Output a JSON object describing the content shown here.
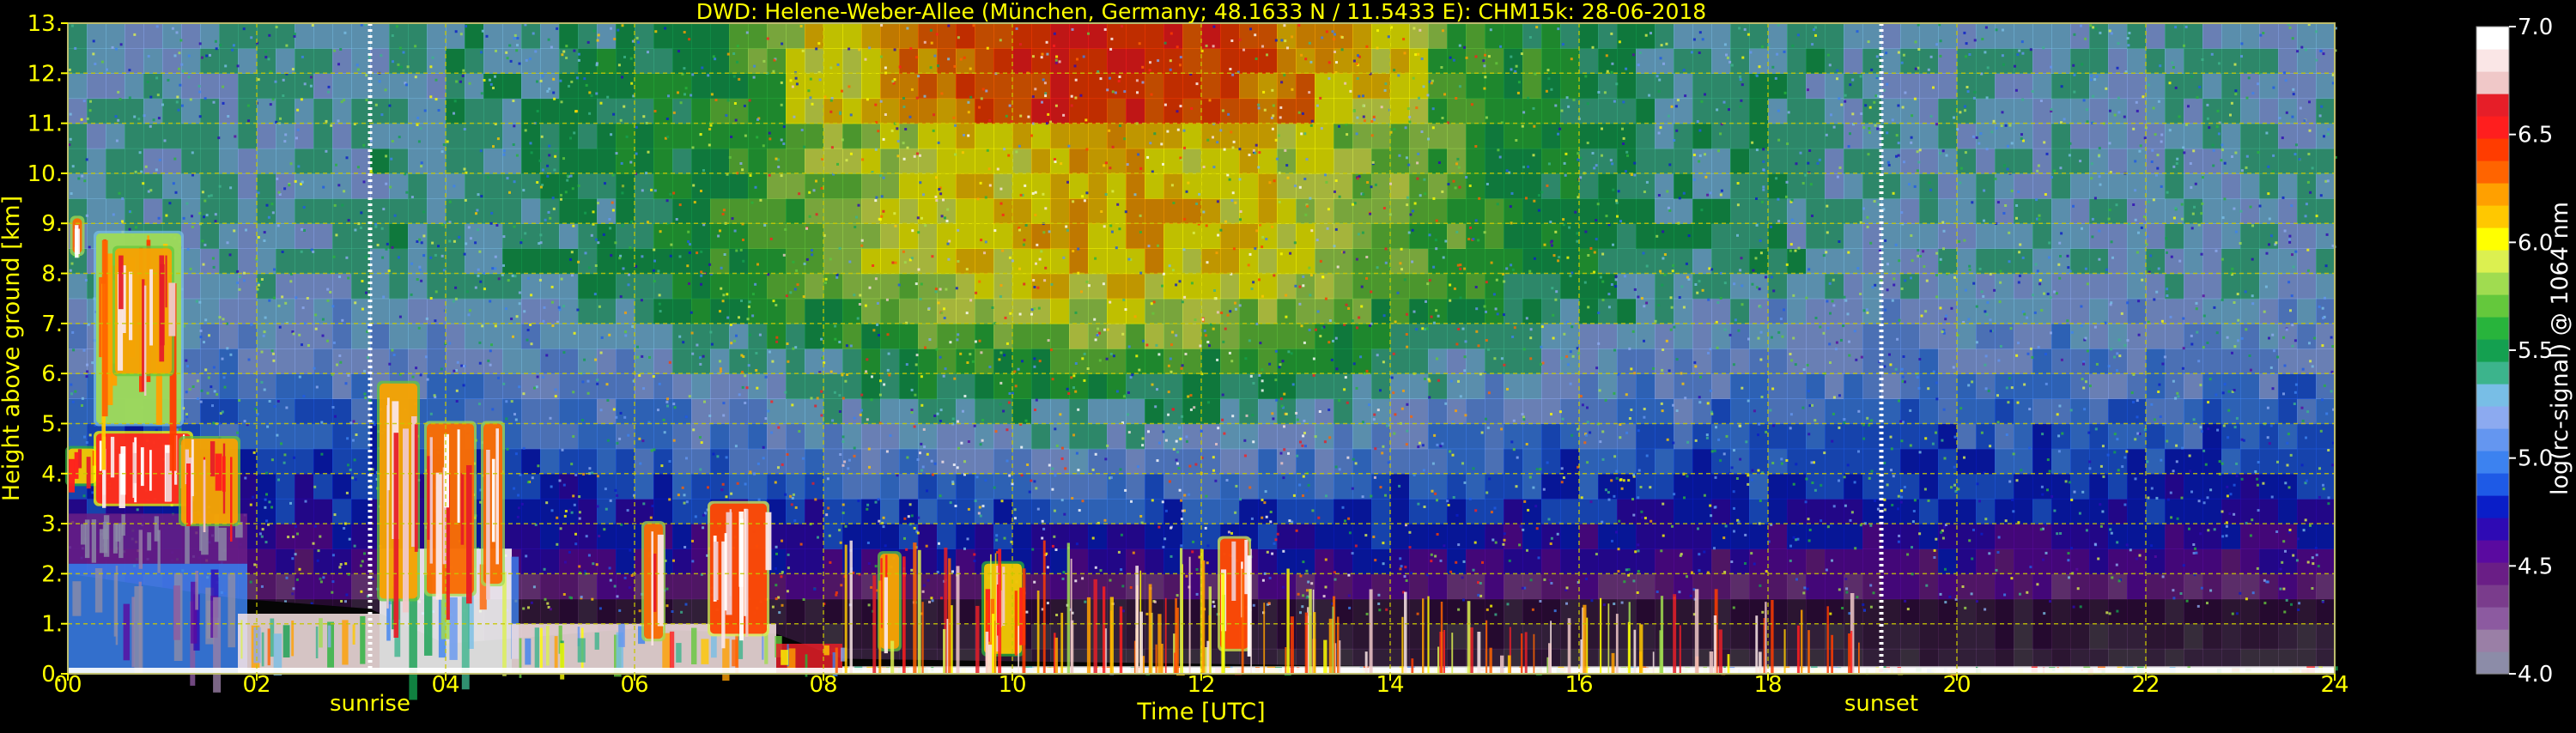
{
  "chart_data": {
    "type": "heatmap",
    "title": "DWD: Helene-Weber-Allee (München, Germany; 48.1633 N / 11.5433 E):    CHM15k: 28-06-2018",
    "xlabel": "Time [UTC]",
    "ylabel": "Height above ground [km]",
    "xlim": [
      0,
      24
    ],
    "ylim": [
      0,
      13
    ],
    "x_ticks": [
      "00",
      "02",
      "04",
      "06",
      "08",
      "10",
      "12",
      "14",
      "16",
      "18",
      "20",
      "22",
      "24"
    ],
    "y_ticks": [
      "0.",
      "1.",
      "2.",
      "3.",
      "4.",
      "5.",
      "6.",
      "7.",
      "8.",
      "9.",
      "10.",
      "11.",
      "12.",
      "13."
    ],
    "grid": true,
    "colorbar": {
      "label": "log(rc-signal) @ 1064 nm",
      "range": [
        4.0,
        7.0
      ],
      "ticks": [
        "4.0",
        "4.5",
        "5.0",
        "5.5",
        "6.0",
        "6.5",
        "7.0"
      ],
      "colors": [
        "#8c8ca8",
        "#9a7fa6",
        "#8c5aa0",
        "#7a3c8c",
        "#6a1e86",
        "#5a0aa0",
        "#2e0ab4",
        "#0a1ec8",
        "#1e5ae6",
        "#3c82f0",
        "#6496f0",
        "#8caaf0",
        "#78bee6",
        "#3cb48c",
        "#14a050",
        "#28b43c",
        "#64c83c",
        "#a0dc50",
        "#dcf050",
        "#ffff00",
        "#ffc800",
        "#ffa000",
        "#ff6400",
        "#ff3c00",
        "#ff1e1e",
        "#e61e28",
        "#f0c8c8",
        "#fae6e6",
        "#ffffff"
      ]
    },
    "annotations": [
      {
        "text": "sunrise",
        "x": 3.2
      },
      {
        "text": "sunset",
        "x": 19.2
      }
    ],
    "boundary_layer_top_km": [
      [
        0,
        2.0
      ],
      [
        1.8,
        1.5
      ],
      [
        3.2,
        1.3
      ],
      [
        4.0,
        0.6
      ],
      [
        6.0,
        0.9
      ],
      [
        7.5,
        0.8
      ],
      [
        8.2,
        0.3
      ],
      [
        10.0,
        0.25
      ],
      [
        12.0,
        0.2
      ],
      [
        14.0,
        0.15
      ],
      [
        18.0,
        0.15
      ],
      [
        19.2,
        0.1
      ],
      [
        24.0,
        0.1
      ]
    ],
    "aerosol_layers": [
      {
        "x": [
          0.0,
          1.9
        ],
        "y": [
          0.0,
          2.2
        ],
        "value": 5.0
      },
      {
        "x": [
          0.0,
          1.9
        ],
        "y": [
          2.2,
          3.2
        ],
        "value": 4.5
      },
      {
        "x": [
          1.8,
          3.3
        ],
        "y": [
          0.0,
          1.2
        ],
        "value": 6.8
      },
      {
        "x": [
          3.3,
          4.7
        ],
        "y": [
          0.0,
          2.5
        ],
        "value": 6.9
      },
      {
        "x": [
          4.7,
          7.5
        ],
        "y": [
          0.0,
          1.0
        ],
        "value": 6.8
      },
      {
        "x": [
          7.5,
          8.2
        ],
        "y": [
          0.0,
          0.6
        ],
        "value": 6.6
      },
      {
        "x": [
          8.2,
          24.0
        ],
        "y": [
          0.0,
          0.15
        ],
        "value": 6.9
      }
    ],
    "clouds": [
      {
        "x": [
          0.0,
          0.3
        ],
        "y": [
          3.8,
          4.5
        ],
        "value": 6.5
      },
      {
        "x": [
          0.3,
          1.3
        ],
        "y": [
          3.4,
          4.8
        ],
        "value": 6.9
      },
      {
        "x": [
          1.2,
          1.8
        ],
        "y": [
          3.0,
          4.7
        ],
        "value": 6.6
      },
      {
        "x": [
          0.3,
          1.2
        ],
        "y": [
          5.0,
          8.8
        ],
        "value": 6.2
      },
      {
        "x": [
          0.5,
          1.1
        ],
        "y": [
          6.0,
          8.5
        ],
        "value": 6.6
      },
      {
        "x": [
          0.05,
          0.15
        ],
        "y": [
          8.4,
          9.1
        ],
        "value": 6.7
      },
      {
        "x": [
          3.3,
          3.7
        ],
        "y": [
          1.5,
          5.8
        ],
        "value": 6.6
      },
      {
        "x": [
          3.8,
          4.3
        ],
        "y": [
          1.6,
          5.0
        ],
        "value": 6.7
      },
      {
        "x": [
          4.4,
          4.6
        ],
        "y": [
          1.8,
          5.0
        ],
        "value": 6.7
      },
      {
        "x": [
          6.1,
          6.3
        ],
        "y": [
          0.7,
          3.0
        ],
        "value": 6.7
      },
      {
        "x": [
          6.8,
          7.4
        ],
        "y": [
          0.8,
          3.4
        ],
        "value": 6.8
      },
      {
        "x": [
          8.6,
          8.8
        ],
        "y": [
          0.5,
          2.4
        ],
        "value": 6.6
      },
      {
        "x": [
          9.7,
          10.1
        ],
        "y": [
          0.4,
          2.2
        ],
        "value": 6.5
      },
      {
        "x": [
          12.2,
          12.5
        ],
        "y": [
          0.5,
          2.7
        ],
        "value": 6.8
      }
    ],
    "background": {
      "near_surface_free_troposphere": 4.6,
      "upper_daytime": 6.1,
      "upper_night": 5.3
    }
  }
}
